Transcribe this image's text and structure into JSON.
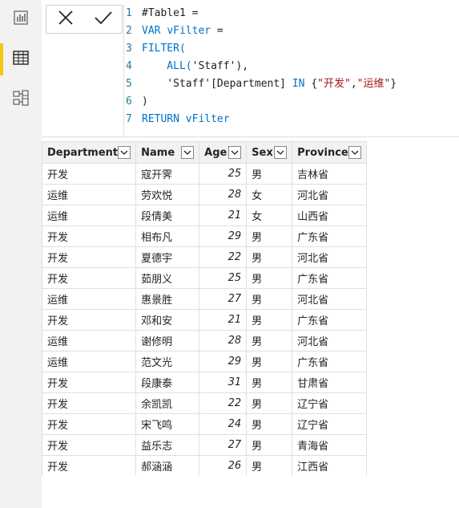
{
  "rail": {
    "items": [
      {
        "name": "report-view-icon",
        "active": false
      },
      {
        "name": "data-view-icon",
        "active": true
      },
      {
        "name": "model-view-icon",
        "active": false
      }
    ]
  },
  "formula": {
    "lines": [
      {
        "n": "1",
        "parts": [
          {
            "t": "#Table1 = ",
            "c": "txt"
          }
        ]
      },
      {
        "n": "2",
        "parts": [
          {
            "t": "VAR ",
            "c": "kw"
          },
          {
            "t": "vFilter",
            "c": "var"
          },
          {
            "t": " =",
            "c": "txt"
          }
        ]
      },
      {
        "n": "3",
        "parts": [
          {
            "t": "FILTER(",
            "c": "fn"
          }
        ]
      },
      {
        "n": "4",
        "parts": [
          {
            "t": "    ALL(",
            "c": "fn"
          },
          {
            "t": "'Staff'",
            "c": "txt"
          },
          {
            "t": "),",
            "c": "txt"
          }
        ]
      },
      {
        "n": "5",
        "parts": [
          {
            "t": "    'Staff'[Department] ",
            "c": "txt"
          },
          {
            "t": "IN",
            "c": "kw"
          },
          {
            "t": " {",
            "c": "txt"
          },
          {
            "t": "\"开发\"",
            "c": "str"
          },
          {
            "t": ",",
            "c": "txt"
          },
          {
            "t": "\"运维\"",
            "c": "str"
          },
          {
            "t": "}",
            "c": "txt"
          }
        ]
      },
      {
        "n": "6",
        "parts": [
          {
            "t": ")",
            "c": "txt"
          }
        ]
      },
      {
        "n": "7",
        "parts": [
          {
            "t": "RETURN ",
            "c": "kw"
          },
          {
            "t": "vFilter",
            "c": "var"
          }
        ]
      }
    ]
  },
  "table": {
    "columns": [
      "Department",
      "Name",
      "Age",
      "Sex",
      "Province"
    ],
    "rows": [
      [
        "开发",
        "寇开霁",
        "25",
        "男",
        "吉林省"
      ],
      [
        "运维",
        "劳欢悦",
        "28",
        "女",
        "河北省"
      ],
      [
        "运维",
        "段倩美",
        "21",
        "女",
        "山西省"
      ],
      [
        "开发",
        "相布凡",
        "29",
        "男",
        "广东省"
      ],
      [
        "开发",
        "夏德宇",
        "22",
        "男",
        "河北省"
      ],
      [
        "开发",
        "茹朋义",
        "25",
        "男",
        "广东省"
      ],
      [
        "运维",
        "惠景胜",
        "27",
        "男",
        "河北省"
      ],
      [
        "开发",
        "邓和安",
        "21",
        "男",
        "广东省"
      ],
      [
        "运维",
        "谢修明",
        "28",
        "男",
        "河北省"
      ],
      [
        "运维",
        "范文光",
        "29",
        "男",
        "广东省"
      ],
      [
        "开发",
        "段康泰",
        "31",
        "男",
        "甘肃省"
      ],
      [
        "开发",
        "余凯凯",
        "22",
        "男",
        "辽宁省"
      ],
      [
        "开发",
        "宋飞鸣",
        "24",
        "男",
        "辽宁省"
      ],
      [
        "开发",
        "益乐志",
        "27",
        "男",
        "青海省"
      ],
      [
        "开发",
        "郝涵涵",
        "26",
        "男",
        "江西省"
      ]
    ]
  }
}
